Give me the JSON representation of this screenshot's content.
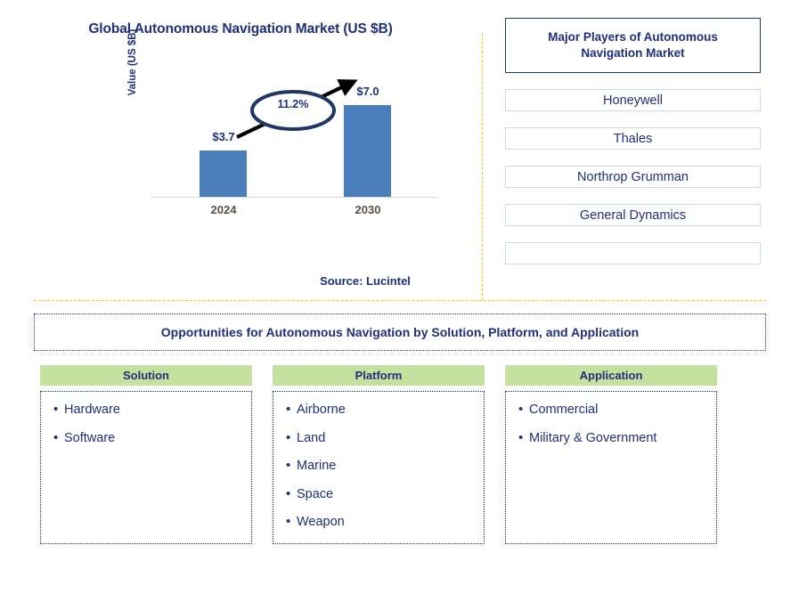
{
  "chart_panel": {
    "title": "Global Autonomous Navigation Market (US $B)",
    "y_axis_label": "Value (US $B)",
    "cagr_label": "11.2%",
    "source": "Source: Lucintel"
  },
  "chart_data": {
    "type": "bar",
    "title": "Global Autonomous Navigation Market (US $B)",
    "categories": [
      "2024",
      "2030"
    ],
    "values": [
      3.7,
      7.0
    ],
    "value_labels": [
      "$3.7",
      "$7.0"
    ],
    "xlabel": "",
    "ylabel": "Value (US $B)",
    "ylim": [
      0,
      8.5
    ],
    "grid": false,
    "legend": "none",
    "bar_color": "#4a7ebb",
    "annotations": [
      {
        "text": "11.2%",
        "type": "cagr-ellipse-arrow",
        "from": "2024",
        "to": "2030"
      }
    ],
    "source": "Source: Lucintel"
  },
  "players": {
    "header": "Major Players of Autonomous Navigation Market",
    "items": [
      {
        "name": "Honeywell"
      },
      {
        "name": "Thales"
      },
      {
        "name": "Northrop Grumman"
      },
      {
        "name": "General Dynamics"
      },
      {
        "name": ""
      }
    ]
  },
  "opportunities": {
    "banner": "Opportunities for Autonomous Navigation by Solution, Platform, and Application",
    "columns": [
      {
        "header": "Solution",
        "items": [
          "Hardware",
          "Software"
        ]
      },
      {
        "header": "Platform",
        "items": [
          "Airborne",
          "Land",
          "Marine",
          "Space",
          "Weapon"
        ]
      },
      {
        "header": "Application",
        "items": [
          "Commercial",
          "Military & Government"
        ]
      }
    ]
  },
  "colors": {
    "navy_text": "#1f2f7a",
    "bar_blue": "#4a7ebb",
    "divider_orange": "#ffc000",
    "header_green": "#c6e0a0",
    "player_border": "#c8dced",
    "axis_gray": "#d9d9d9",
    "category_label": "#585040"
  }
}
